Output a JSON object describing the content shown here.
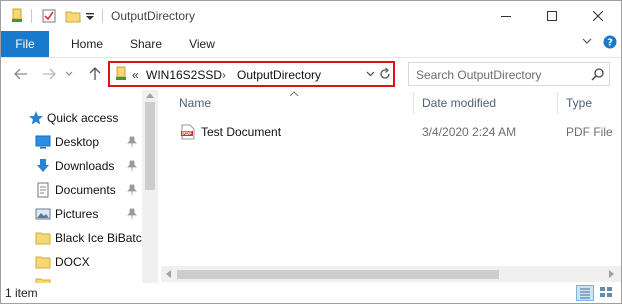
{
  "window": {
    "title": "OutputDirectory",
    "controls": [
      "minimize",
      "maximize",
      "close"
    ]
  },
  "ribbon": {
    "tabs": [
      "File",
      "Home",
      "Share",
      "View"
    ]
  },
  "address": {
    "overflow": "«",
    "crumbs": [
      "WIN16S2SSD",
      "OutputDirectory"
    ],
    "separator": "›"
  },
  "search": {
    "placeholder": "Search OutputDirectory"
  },
  "nav": {
    "quick_access": "Quick access",
    "items": [
      {
        "label": "Desktop",
        "icon": "desktop-icon",
        "pinned": true
      },
      {
        "label": "Downloads",
        "icon": "download-icon",
        "pinned": true
      },
      {
        "label": "Documents",
        "icon": "document-icon",
        "pinned": true
      },
      {
        "label": "Pictures",
        "icon": "picture-icon",
        "pinned": true
      },
      {
        "label": "Black Ice BiBatch",
        "icon": "folder-icon",
        "pinned": false
      },
      {
        "label": "DOCX",
        "icon": "folder-icon",
        "pinned": false
      }
    ]
  },
  "content": {
    "columns": [
      "Name",
      "Date modified",
      "Type"
    ],
    "rows": [
      {
        "name": "Test Document",
        "date": "3/4/2020 2:24 AM",
        "type": "PDF File",
        "icon": "pdf-icon"
      }
    ]
  },
  "status": {
    "count": "1 item"
  },
  "colors": {
    "file_tab": "#1979ca",
    "highlight_box": "#e0101a",
    "folder": "#f8d775",
    "header_text": "#4c607a"
  }
}
